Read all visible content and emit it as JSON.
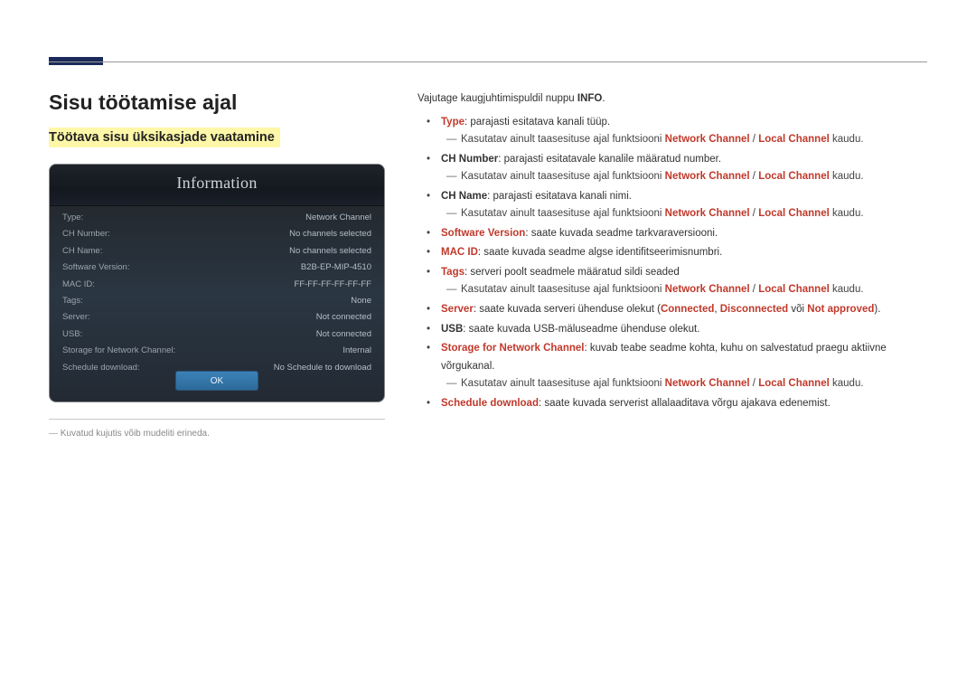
{
  "h1": "Sisu töötamise ajal",
  "section_title": "Töötava sisu üksikasjade vaatamine",
  "info_panel": {
    "title": "Information",
    "rows": [
      {
        "k": "Type:",
        "v": "Network Channel"
      },
      {
        "k": "CH Number:",
        "v": "No channels selected"
      },
      {
        "k": "CH Name:",
        "v": "No channels selected"
      },
      {
        "k": "Software Version:",
        "v": "B2B-EP-MIP-4510"
      },
      {
        "k": "MAC ID:",
        "v": "FF-FF-FF-FF-FF-FF"
      },
      {
        "k": "Tags:",
        "v": "None"
      },
      {
        "k": "Server:",
        "v": "Not connected"
      },
      {
        "k": "USB:",
        "v": "Not connected"
      },
      {
        "k": "Storage for Network Channel:",
        "v": "Internal"
      },
      {
        "k": "Schedule download:",
        "v": "No Schedule to download"
      }
    ],
    "ok": "OK"
  },
  "img_note": "Kuvatud kujutis võib mudeliti erineda.",
  "lead_pre": "Vajutage kaugjuhtimispuldil nuppu ",
  "lead_bold": "INFO",
  "lead_post": ".",
  "sub_common_pre": "Kasutatav ainult taasesituse ajal funktsiooni ",
  "sub_common_nc": "Network Channel",
  "sub_common_sep": " / ",
  "sub_common_lc": "Local Channel",
  "sub_common_post": " kaudu.",
  "items": {
    "type_label": "Type",
    "type_desc": ": parajasti esitatava kanali tüüp.",
    "chnum_label": "CH Number",
    "chnum_desc": ": parajasti esitatavale kanalile määratud number.",
    "chname_label": "CH Name",
    "chname_desc": ": parajasti esitatava kanali nimi.",
    "sw_label": "Software Version",
    "sw_desc": ": saate kuvada seadme tarkvaraversiooni.",
    "mac_label": "MAC ID",
    "mac_desc": ": saate kuvada seadme algse identifitseerimisnumbri.",
    "tags_label": "Tags",
    "tags_desc": ": serveri poolt seadmele määratud sildi seaded",
    "server_label": "Server",
    "server_desc_pre": ": saate kuvada serveri ühenduse olekut (",
    "server_conn": "Connected",
    "server_sep1": ", ",
    "server_disc": "Disconnected",
    "server_sep2": " või ",
    "server_na": "Not approved",
    "server_desc_post": ").",
    "usb_label": "USB",
    "usb_desc": ": saate kuvada USB-mäluseadme ühenduse olekut.",
    "storage_label": "Storage for Network Channel",
    "storage_desc": ": kuvab teabe seadme kohta, kuhu on salvestatud praegu aktiivne võrgukanal.",
    "sched_label": "Schedule download",
    "sched_desc": ": saate kuvada serverist allalaaditava võrgu ajakava edenemist."
  }
}
